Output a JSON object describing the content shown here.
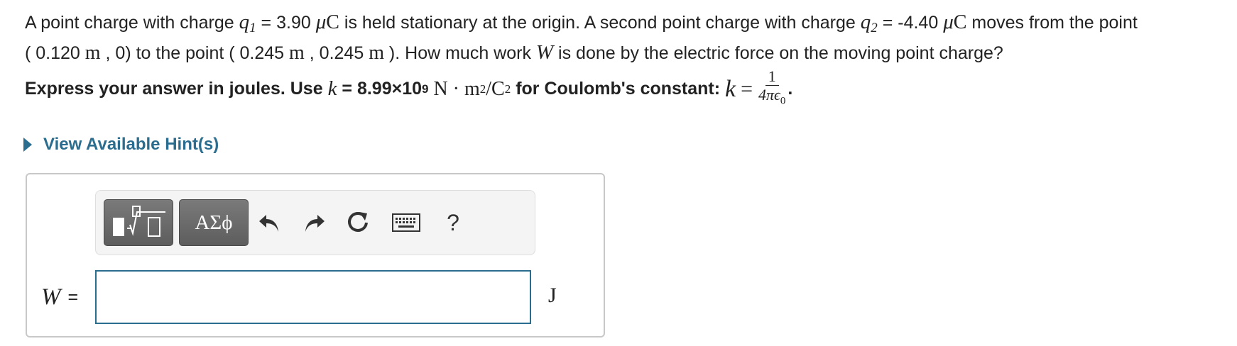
{
  "problem": {
    "p1": "A point charge with charge",
    "q1_sym": "q",
    "q1_sub": "1",
    "q1_val": "= 3.90",
    "mu": "μ",
    "c": "C",
    "p2": "is held stationary at the origin. A second point charge with charge",
    "q2_sym": "q",
    "q2_sub": "2",
    "q2_val": "= -4.40",
    "p3": "moves from the point",
    "pt1_open": "( 0.120",
    "m": "m",
    "pt1_close": ", 0) to the point ( 0.245",
    "pt2_mid": ", 0.245",
    "p4": "). How much work",
    "w_sym": "W",
    "p5": "is done by the electric force on the moving point charge?"
  },
  "instruction": {
    "i1": "Express your answer in joules. Use",
    "k_sym": "k",
    "k_val": "= 8.99×10",
    "k_exp": "9",
    "units_a": "N · m",
    "units_exp": "2",
    "units_b": "/C",
    "units_exp2": "2",
    "i2": "for Coulomb's constant:",
    "k_sym2": "k",
    "eq": "=",
    "frac_num": "1",
    "frac_den": "4πϵ",
    "frac_den_sub": "0",
    "period": "."
  },
  "hint": {
    "label": "View Available Hint(s)"
  },
  "toolbar": {
    "symbols_label": "ΑΣϕ",
    "help_label": "?",
    "icons": [
      "templates-icon",
      "undo-icon",
      "redo-icon",
      "reset-icon",
      "keyboard-icon",
      "help-icon"
    ]
  },
  "answer": {
    "var": "W",
    "eq": "=",
    "value": "",
    "unit": "J"
  },
  "colors": {
    "accent": "#2b6d8f",
    "toolbar_button": "#666666",
    "border": "#c8c8c8"
  }
}
